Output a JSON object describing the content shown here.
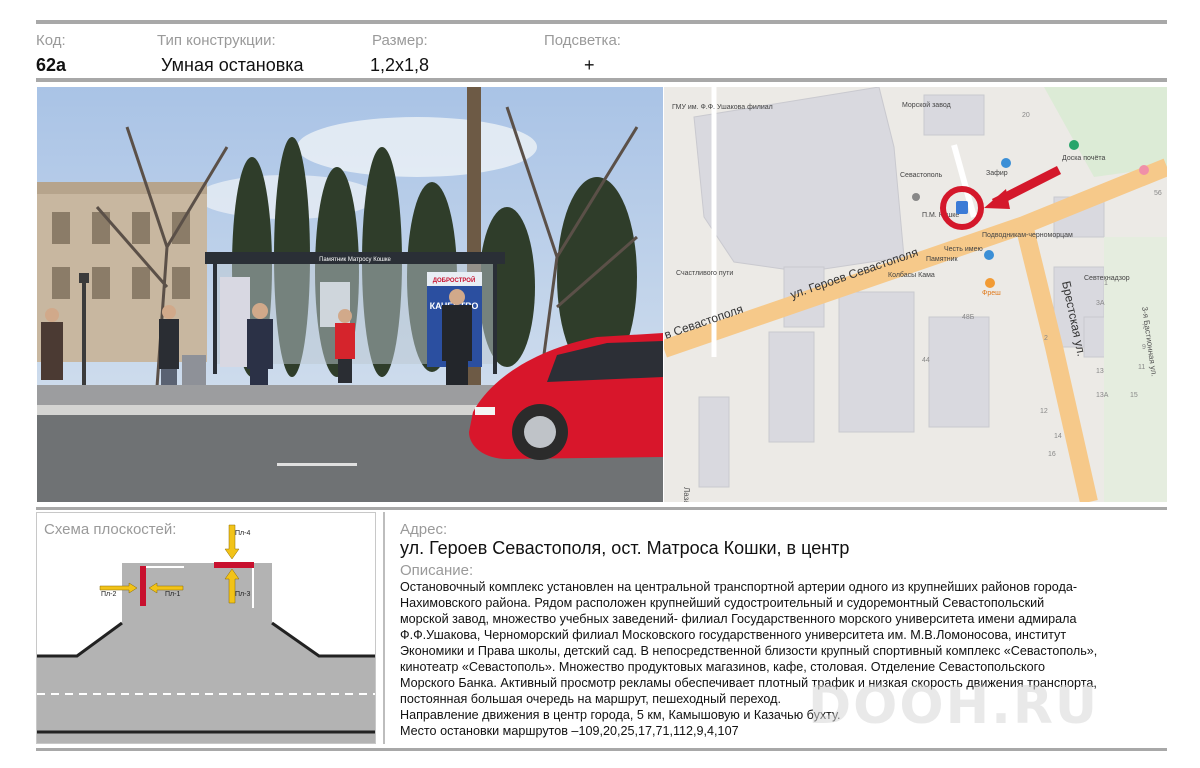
{
  "header": {
    "code_label": "Код:",
    "code_value": "62а",
    "type_label": "Тип конструкции:",
    "type_value": "Умная остановка",
    "size_label": "Размер:",
    "size_value": "1,2х1,8",
    "light_label": "Подсветка:",
    "light_value": "+"
  },
  "photo": {
    "shelter_sign": "Памятник Матросу Кошке",
    "ad_brand": "ДОБРОСТРОЙ",
    "ad_text": "КАЧЕСТВО"
  },
  "map": {
    "labels": [
      "ГМУ им. Ф.Ф. Ушакова филиал",
      "Морской завод",
      "Доска почёта",
      "Севастополь",
      "Зафир",
      "П.М. Кошке",
      "Подводникам-черноморцам",
      "Памятник",
      "Честь имею",
      "Колбасы Кама",
      "Фреш",
      "Счастливого пути",
      "Севтехнадзор",
      "ул. Героев Севастополя",
      "в Севастополя",
      "Брестская ул.",
      "3-я Бастионная ул.",
      "Лаза"
    ],
    "numbers": [
      "20",
      "56",
      "48Б",
      "44",
      "2",
      "1",
      "3А",
      "7",
      "9",
      "11",
      "13",
      "13А",
      "15",
      "12",
      "14",
      "16"
    ]
  },
  "scheme": {
    "title": "Схема плоскостей:",
    "pl1": "Пл-1",
    "pl2": "Пл-2",
    "pl3": "Пл-3",
    "pl4": "Пл-4"
  },
  "info": {
    "address_label": "Адрес:",
    "address_value": "ул. Героев Севастополя, ост. Матроса Кошки, в центр",
    "desc_label": "Описание:",
    "desc_lines": [
      "Остановочный комплекс установлен на центральной транспортной артерии  одного из крупнейших районов города-",
      "Нахимовского района. Рядом расположен крупнейший судостроительный и судоремонтный   Севастопольский",
      "морской завод, множество учебных заведений- филиал Государственного морского университета имени адмирала",
      "Ф.Ф.Ушакова, Черноморский филиал Московского государственного университета им.  М.В.Ломоносова, институт",
      "Экономики и Права школы, детский сад. В непосредственной близости крупный спортивный комплекс «Севастополь»,",
      "кинотеатр «Севастополь». Множество продуктовых магазинов, кафе, столовая. Отделение Севастопольского",
      "Морского Банка. Активный просмотр рекламы обеспечивает плотный трафик и низкая скорость движения транспорта,",
      "постоянная большая очередь на маршрут, пешеходный переход.",
      "Направление движения в центр города, 5 км, Камышовую и Казачью бухту.",
      "Место остановки маршрутов –109,20,25,17,71,112,9,4,107"
    ]
  },
  "watermark": "DOOH.RU",
  "colors": {
    "rule": "#a8a8a8",
    "road": "#f6c98a",
    "marker": "#d4182b",
    "plane_red": "#c8102e",
    "arrow_yellow": "#f2c318",
    "car": "#d8162b"
  }
}
